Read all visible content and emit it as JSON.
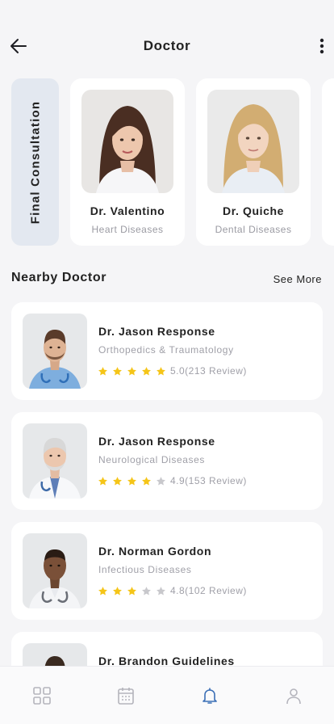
{
  "header": {
    "title": "Doctor",
    "back_icon": "arrow-left-icon",
    "more_icon": "more-vertical-icon"
  },
  "final_tab": {
    "label": "Final Consultation"
  },
  "featured": [
    {
      "name": "Dr. Valentino",
      "specialty": "Heart Diseases"
    },
    {
      "name": "Dr. Quiche",
      "specialty": "Dental Diseases"
    }
  ],
  "nearby": {
    "title": "Nearby Doctor",
    "see_more": "See More",
    "doctors": [
      {
        "name": "Dr. Jason Response",
        "specialty": "Orthopedics & Traumatology",
        "stars": 5,
        "rating_text": "5.0(213 Review)"
      },
      {
        "name": "Dr. Jason Response",
        "specialty": "Neurological Diseases",
        "stars": 4,
        "rating_text": "4.9(153 Review)"
      },
      {
        "name": "Dr. Norman Gordon",
        "specialty": "Infectious Diseases",
        "stars": 3,
        "rating_text": "4.8(102 Review)"
      },
      {
        "name": "Dr. Brandon Guidelines",
        "specialty": "",
        "stars": 0,
        "rating_text": ""
      }
    ]
  },
  "bottom_nav": [
    {
      "icon": "grid-icon",
      "active": false
    },
    {
      "icon": "calendar-icon",
      "active": false
    },
    {
      "icon": "bell-icon",
      "active": true
    },
    {
      "icon": "user-icon",
      "active": false
    }
  ],
  "colors": {
    "background": "#f5f5f7",
    "card": "#ffffff",
    "accent_tab": "#e3e8f0",
    "star_filled": "#f5c518",
    "star_empty": "#c8c8cc",
    "nav_active": "#3b6fb6",
    "nav_inactive": "#b4b4bc"
  }
}
